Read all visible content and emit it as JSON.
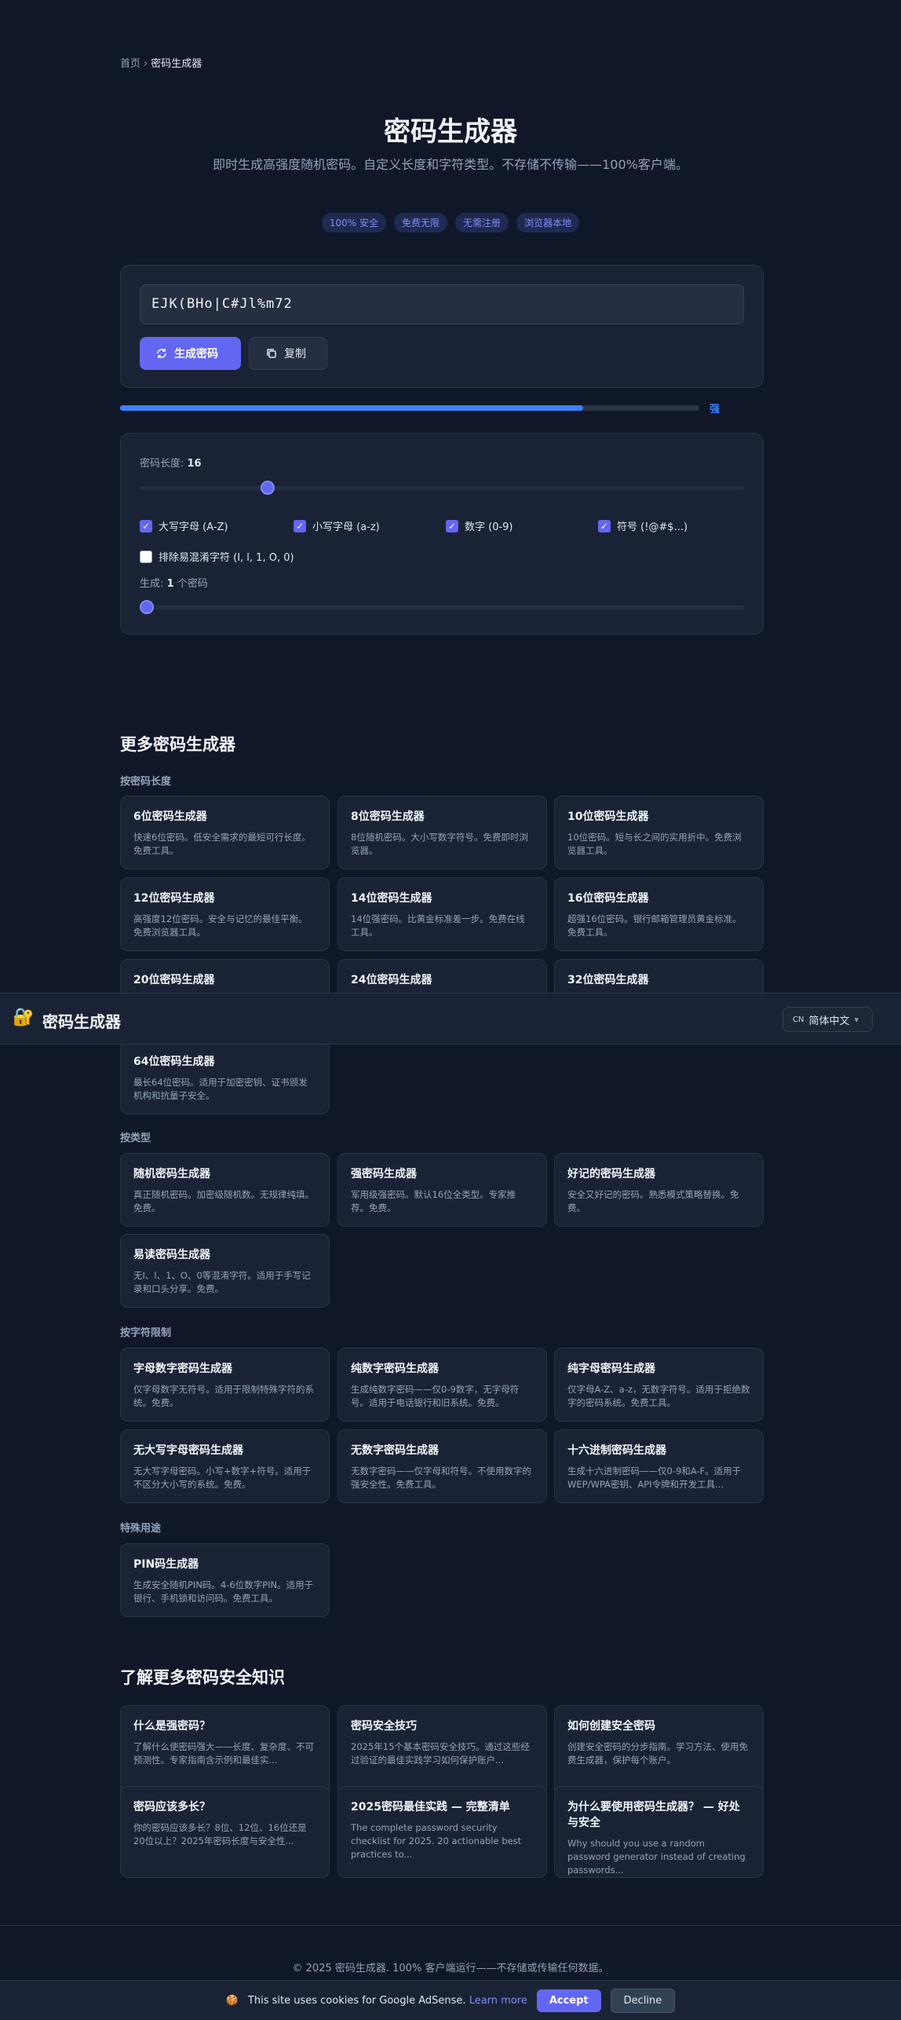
{
  "breadcrumb": {
    "home": "首页",
    "sep": "›",
    "current": "密码生成器"
  },
  "hero": {
    "title": "密码生成器",
    "subtitle": "即时生成高强度随机密码。自定义长度和字符类型。不存储不传输——100%客户端。",
    "badges": [
      "100% 安全",
      "免费无限",
      "无需注册",
      "浏览器本地"
    ]
  },
  "generator": {
    "password": "EJK(BHo|C#Jl%m72",
    "generate_label": "生成密码",
    "copy_label": "复制",
    "strength_label": "强",
    "strength_value": 0.8,
    "accent": "#6366f1"
  },
  "options": {
    "length_label": "密码长度: ",
    "length_value": "16",
    "length_fraction": 0.2,
    "checks": [
      {
        "label": "大写字母 (A-Z)",
        "checked": true
      },
      {
        "label": "小写字母 (a-z)",
        "checked": true
      },
      {
        "label": "数字 (0-9)",
        "checked": true
      },
      {
        "label": "符号 (!@#$...)",
        "checked": true
      },
      {
        "label": "排除易混淆字符 (I, l, 1, O, 0)",
        "checked": false
      }
    ],
    "count_label_pre": "生成: ",
    "count_value": "1",
    "count_label_post": " 个密码",
    "count_fraction": 0.0
  },
  "more": {
    "title": "更多密码生成器",
    "groups": [
      {
        "label": "按密码长度",
        "items": [
          {
            "title": "6位密码生成器",
            "desc": "快速6位密码。低安全需求的最短可行长度。免费工具。"
          },
          {
            "title": "8位密码生成器",
            "desc": "8位随机密码。大小写数字符号。免费即时浏览器。"
          },
          {
            "title": "10位密码生成器",
            "desc": "10位密码。短与长之间的实用折中。免费浏览器工具。"
          },
          {
            "title": "12位密码生成器",
            "desc": "高强度12位密码。安全与记忆的最佳平衡。免费浏览器工具。"
          },
          {
            "title": "14位密码生成器",
            "desc": "14位强密码。比黄金标准差一步。免费在线工具。"
          },
          {
            "title": "16位密码生成器",
            "desc": "超强16位密码。银行邮箱管理员黄金标准。免费工具。"
          },
          {
            "title": "20位密码生成器",
            "desc": ""
          },
          {
            "title": "24位密码生成器",
            "desc": ""
          },
          {
            "title": "32位密码生成器",
            "desc": ""
          },
          {
            "title": "64位密码生成器",
            "desc": "最长64位密码。适用于加密密钥、证书颁发机构和抗量子安全。"
          }
        ]
      },
      {
        "label": "按类型",
        "items": [
          {
            "title": "随机密码生成器",
            "desc": "真正随机密码。加密级随机数。无规律纯填。免费。"
          },
          {
            "title": "强密码生成器",
            "desc": "军用级强密码。默认16位全类型。专家推荐。免费。"
          },
          {
            "title": "好记的密码生成器",
            "desc": "安全又好记的密码。熟悉模式策略替换。免费。"
          },
          {
            "title": "易读密码生成器",
            "desc": "无I、l、1、O、0等混淆字符。适用于手写记录和口头分享。免费。"
          }
        ]
      },
      {
        "label": "按字符限制",
        "items": [
          {
            "title": "字母数字密码生成器",
            "desc": "仅字母数字无符号。适用于限制特殊字符的系统。免费。"
          },
          {
            "title": "纯数字密码生成器",
            "desc": "生成纯数字密码——仅0-9数字，无字母符号。适用于电话银行和旧系统。免费。"
          },
          {
            "title": "纯字母密码生成器",
            "desc": "仅字母A-Z、a-z，无数字符号。适用于拒绝数字的密码系统。免费工具。"
          },
          {
            "title": "无大写字母密码生成器",
            "desc": "无大写字母密码。小写+数字+符号。适用于不区分大小写的系统。免费。"
          },
          {
            "title": "无数字密码生成器",
            "desc": "无数字密码——仅字母和符号。不使用数字的强安全性。免费工具。"
          },
          {
            "title": "十六进制密码生成器",
            "desc": "生成十六进制密码——仅0-9和A-F。适用于WEP/WPA密钥、API令牌和开发工具..."
          }
        ]
      },
      {
        "label": "特殊用途",
        "items": [
          {
            "title": "PIN码生成器",
            "desc": "生成安全随机PIN码。4-6位数字PIN。适用于银行、手机锁和访问码。免费工具。"
          }
        ]
      }
    ]
  },
  "learn": {
    "title": "了解更多密码安全知识",
    "items": [
      {
        "title": "什么是强密码？",
        "desc": "了解什么使密码强大——长度、复杂度、不可预测性。专家指南含示例和最佳实..."
      },
      {
        "title": "密码安全技巧",
        "desc": "2025年15个基本密码安全技巧。通过这些经过验证的最佳实践学习如何保护账户..."
      },
      {
        "title": "如何创建安全密码",
        "desc": "创建安全密码的分步指南。学习方法、使用免费生成器，保护每个账户。"
      },
      {
        "title": "密码应该多长？",
        "desc": "你的密码应该多长？8位、12位、16位还是20位以上？2025年密码长度与安全性..."
      },
      {
        "title": "2025密码最佳实践 — 完整清单",
        "desc": "The complete password security checklist for 2025. 20 actionable best practices to..."
      },
      {
        "title": "为什么要使用密码生成器？ — 好处与安全",
        "desc": "Why should you use a random password generator instead of creating passwords..."
      }
    ]
  },
  "header": {
    "logo_icon": "lock-icon",
    "brand": "密码生成器",
    "lang_code": "CN",
    "lang_label": "简体中文",
    "lang_caret": "▾"
  },
  "footer": {
    "text": "© 2025 密码生成器. 100% 客户端运行——不存储或传输任何数据。"
  },
  "cookie": {
    "text": "This site uses cookies for Google AdSense.",
    "learn_more": "Learn more",
    "accept": "Accept",
    "decline": "Decline"
  }
}
